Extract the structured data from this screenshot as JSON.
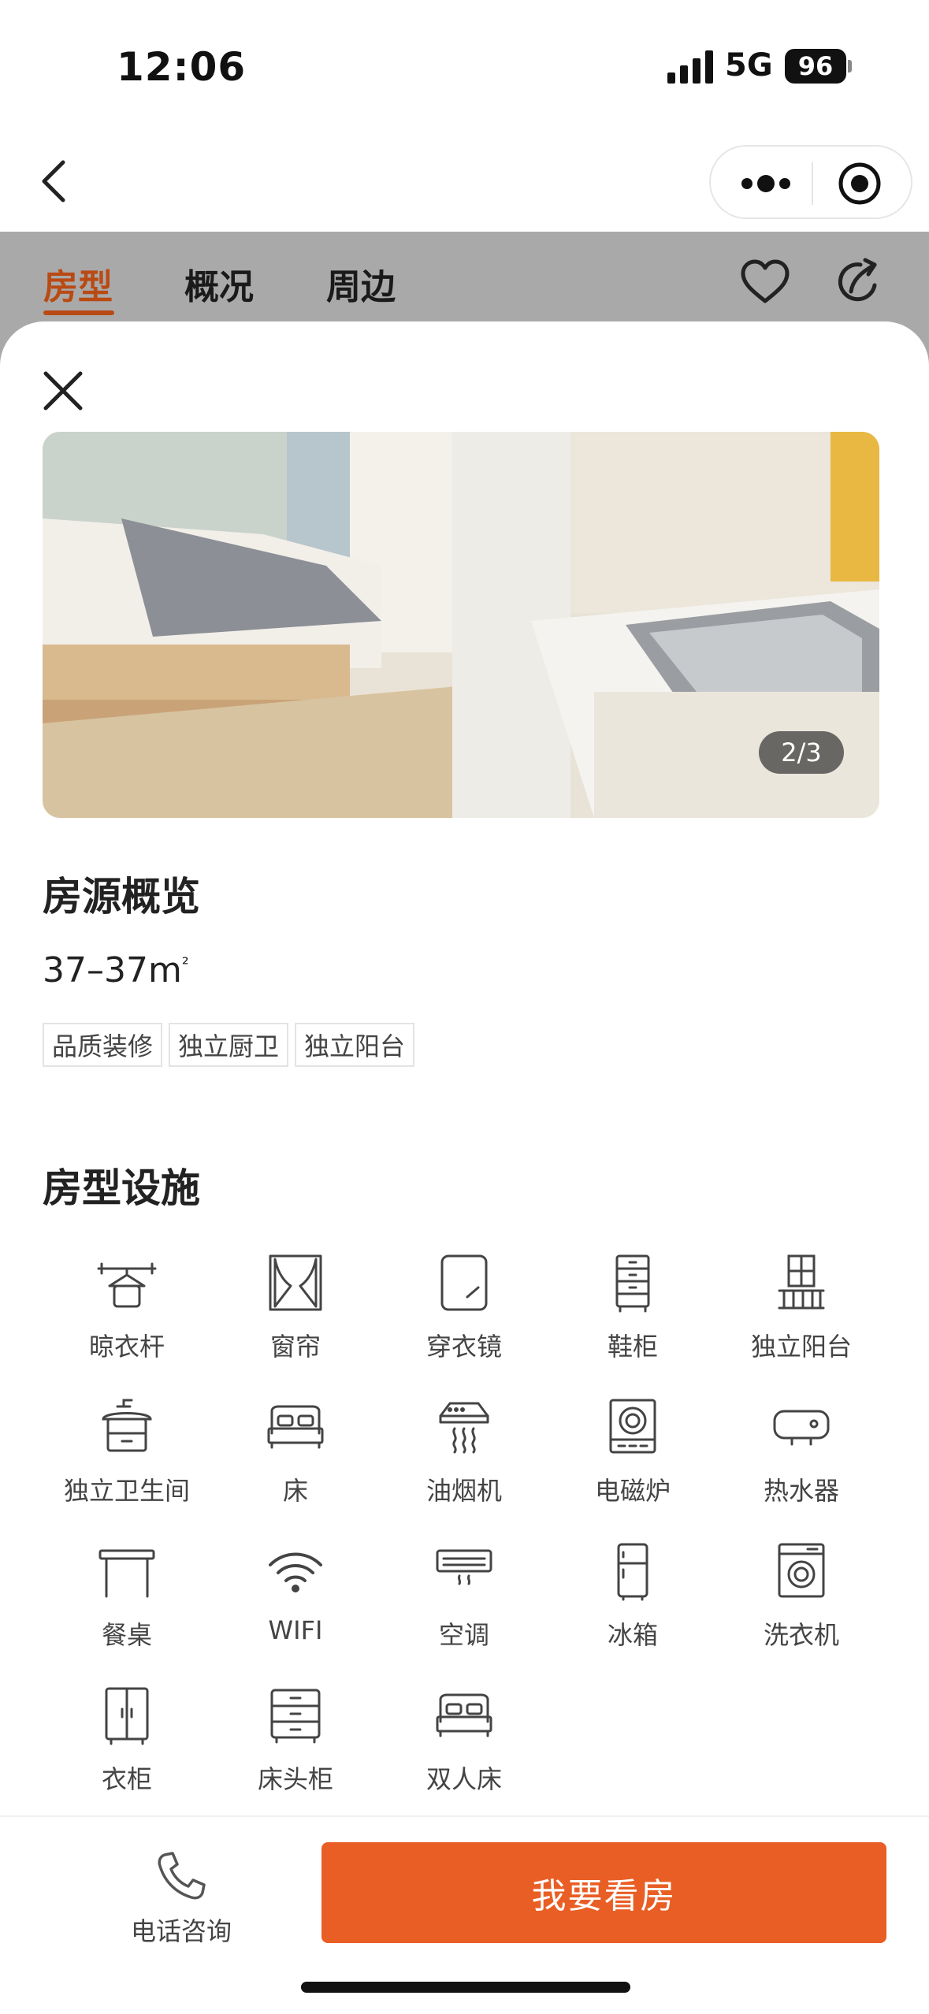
{
  "status_bar": {
    "time": "12:06",
    "network": "5G",
    "battery": "96"
  },
  "nav": {
    "back_icon": "chevron-left-icon",
    "more_icon": "more-dots-icon",
    "close_icon": "record-circle-icon"
  },
  "bg_tabs": [
    {
      "label": "房型",
      "active": true
    },
    {
      "label": "概况",
      "active": false
    },
    {
      "label": "周边",
      "active": false
    }
  ],
  "bg_icons": [
    "heart-icon",
    "share-icon"
  ],
  "sheet": {
    "photo_counter": "2/3",
    "overview_title": "房源概览",
    "area": "37–37m",
    "area_unit_sup": "²",
    "tags": [
      "品质装修",
      "独立厨卫",
      "独立阳台"
    ],
    "facilities_title": "房型设施",
    "facilities": [
      {
        "label": "晾衣杆",
        "icon": "hanger-icon"
      },
      {
        "label": "窗帘",
        "icon": "curtain-icon"
      },
      {
        "label": "穿衣镜",
        "icon": "mirror-icon"
      },
      {
        "label": "鞋柜",
        "icon": "shoe-cabinet-icon"
      },
      {
        "label": "独立阳台",
        "icon": "balcony-icon"
      },
      {
        "label": "独立卫生间",
        "icon": "bathroom-icon"
      },
      {
        "label": "床",
        "icon": "bed-icon"
      },
      {
        "label": "油烟机",
        "icon": "range-hood-icon"
      },
      {
        "label": "电磁炉",
        "icon": "induction-cooker-icon"
      },
      {
        "label": "热水器",
        "icon": "water-heater-icon"
      },
      {
        "label": "餐桌",
        "icon": "dining-table-icon"
      },
      {
        "label": "WIFI",
        "icon": "wifi-icon"
      },
      {
        "label": "空调",
        "icon": "air-conditioner-icon"
      },
      {
        "label": "冰箱",
        "icon": "fridge-icon"
      },
      {
        "label": "洗衣机",
        "icon": "washing-machine-icon"
      },
      {
        "label": "衣柜",
        "icon": "wardrobe-icon"
      },
      {
        "label": "床头柜",
        "icon": "nightstand-icon"
      },
      {
        "label": "双人床",
        "icon": "double-bed-icon"
      }
    ]
  },
  "bottom_bar": {
    "phone_label": "电话咨询",
    "cta_label": "我要看房"
  },
  "colors": {
    "accent": "#e95e24",
    "tab_active": "#b94a14",
    "backdrop": "#a9a9a9"
  }
}
